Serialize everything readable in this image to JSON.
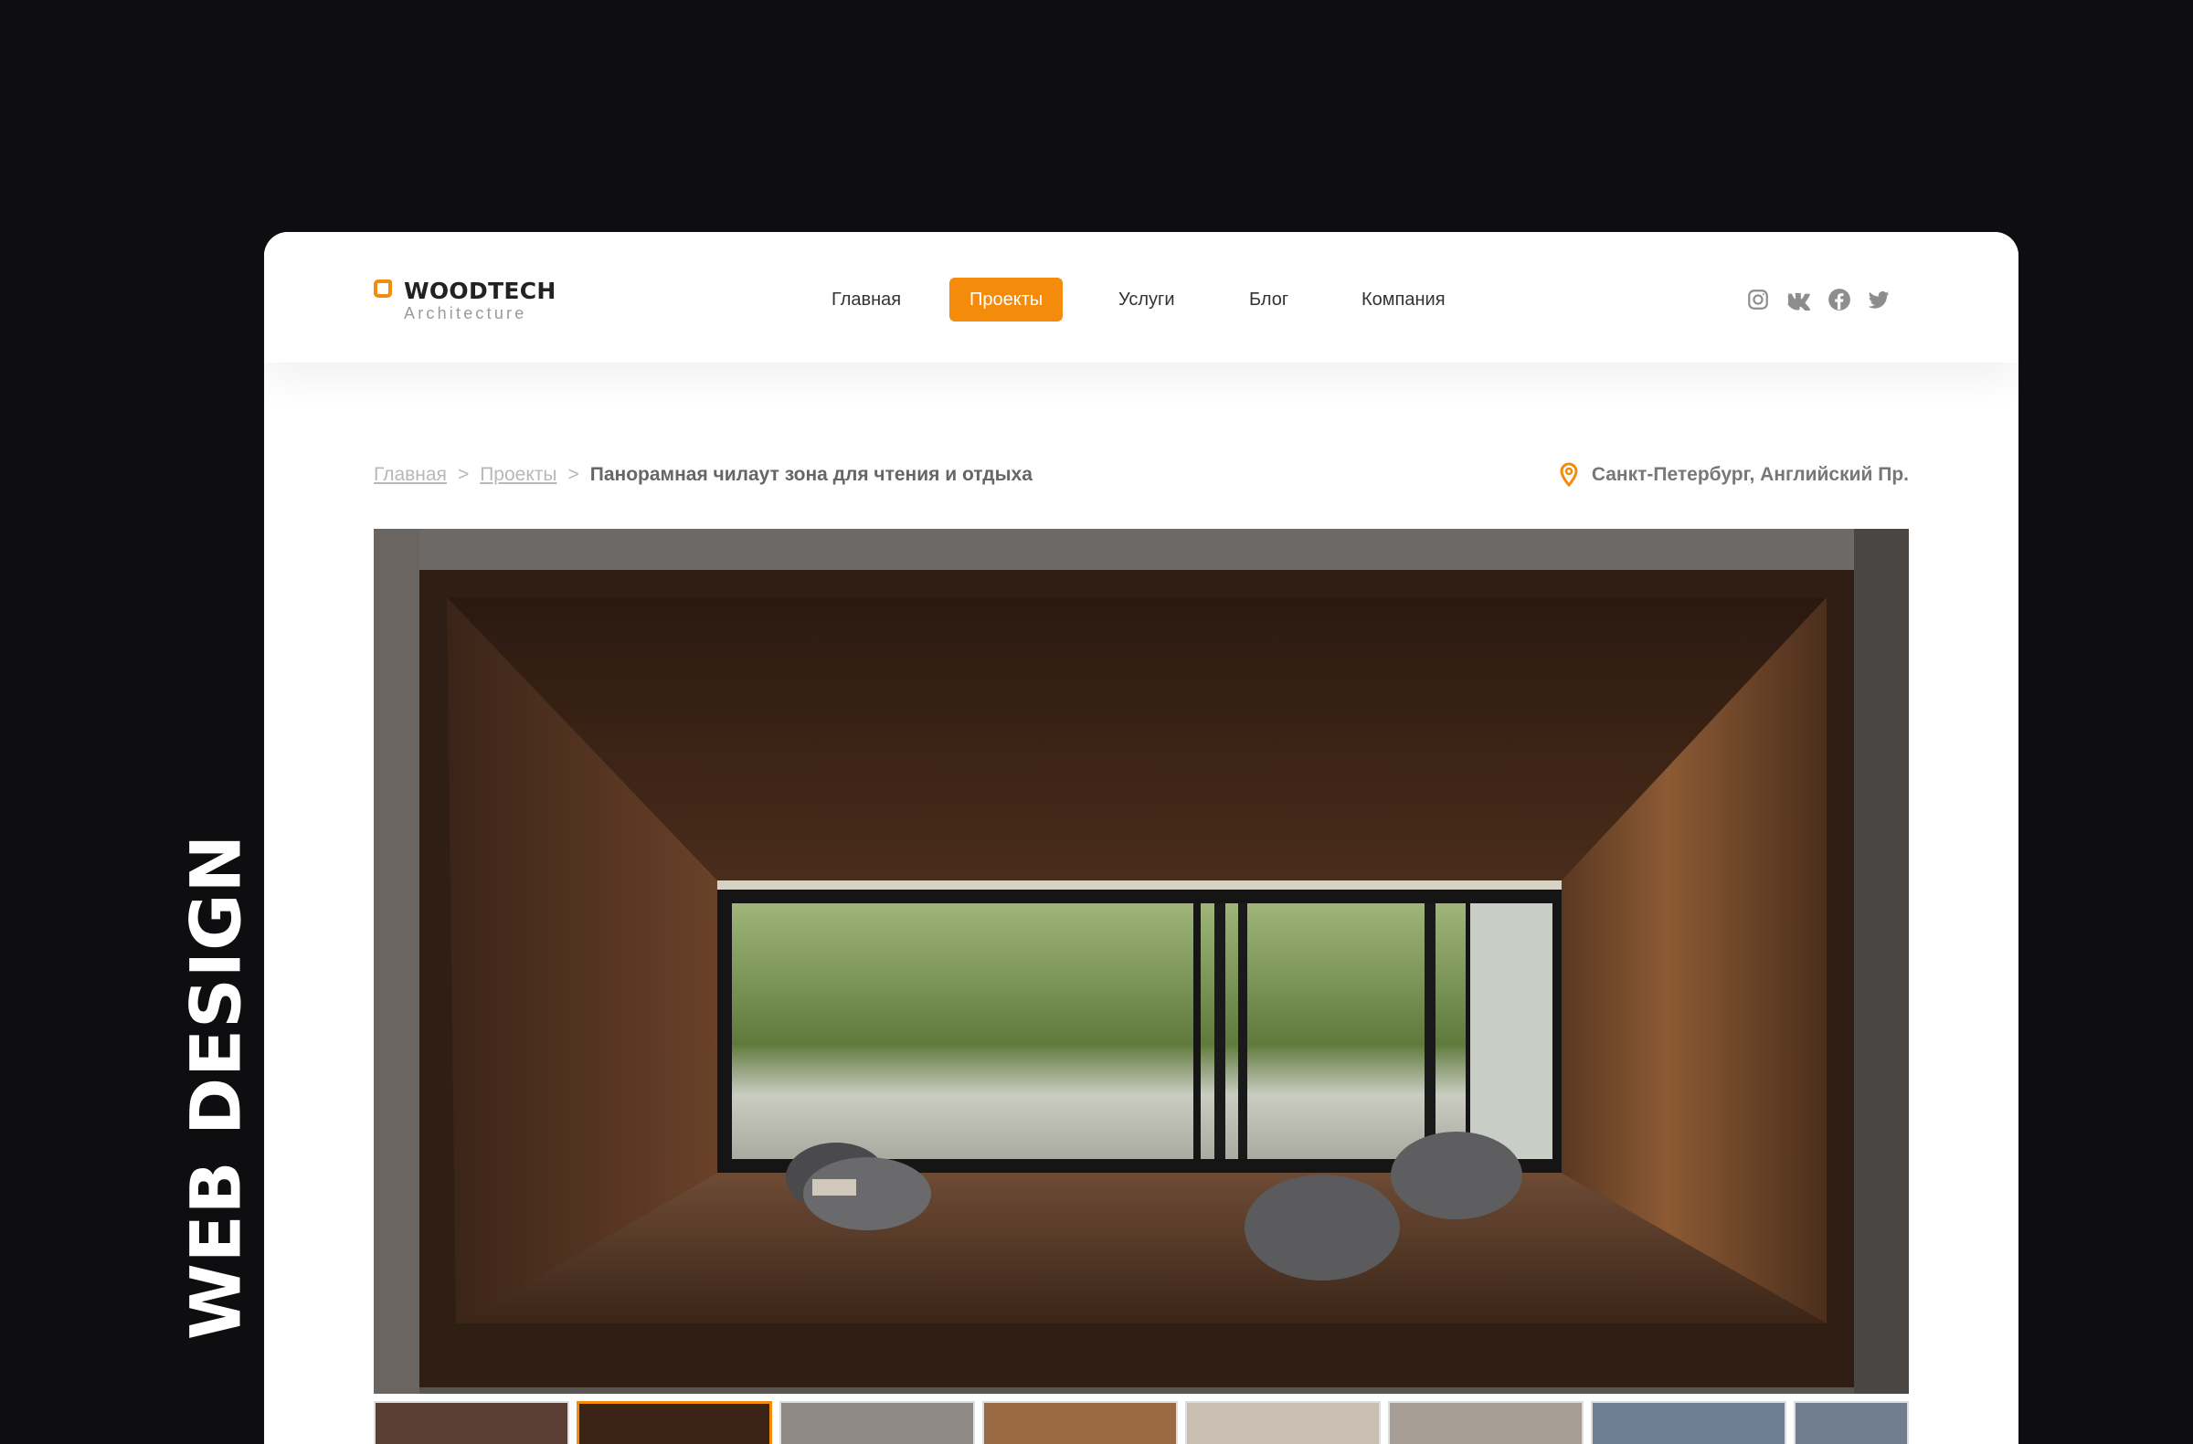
{
  "side_label": "WEB DESIGN",
  "logo": {
    "name": "WOODTECH",
    "subtitle": "Architecture"
  },
  "nav": {
    "items": [
      {
        "label": "Главная",
        "active": false
      },
      {
        "label": "Проекты",
        "active": true
      },
      {
        "label": "Услуги",
        "active": false
      },
      {
        "label": "Блог",
        "active": false
      },
      {
        "label": "Компания",
        "active": false
      }
    ]
  },
  "socials": [
    "instagram-icon",
    "vk-icon",
    "facebook-icon",
    "twitter-icon"
  ],
  "breadcrumb": {
    "home": "Главная",
    "projects": "Проекты",
    "separator": ">",
    "current": "Панорамная чилаут зона для чтения и отдыха"
  },
  "location": {
    "icon": "map-pin-icon",
    "text": "Санкт-Петербург, Английский Пр."
  },
  "colors": {
    "accent": "#f58b0b",
    "page_bg": "#0e0e11",
    "text": "#333333",
    "muted": "#b8b8b8"
  },
  "gallery": {
    "thumbnail_count": 8,
    "active_index": 1
  }
}
